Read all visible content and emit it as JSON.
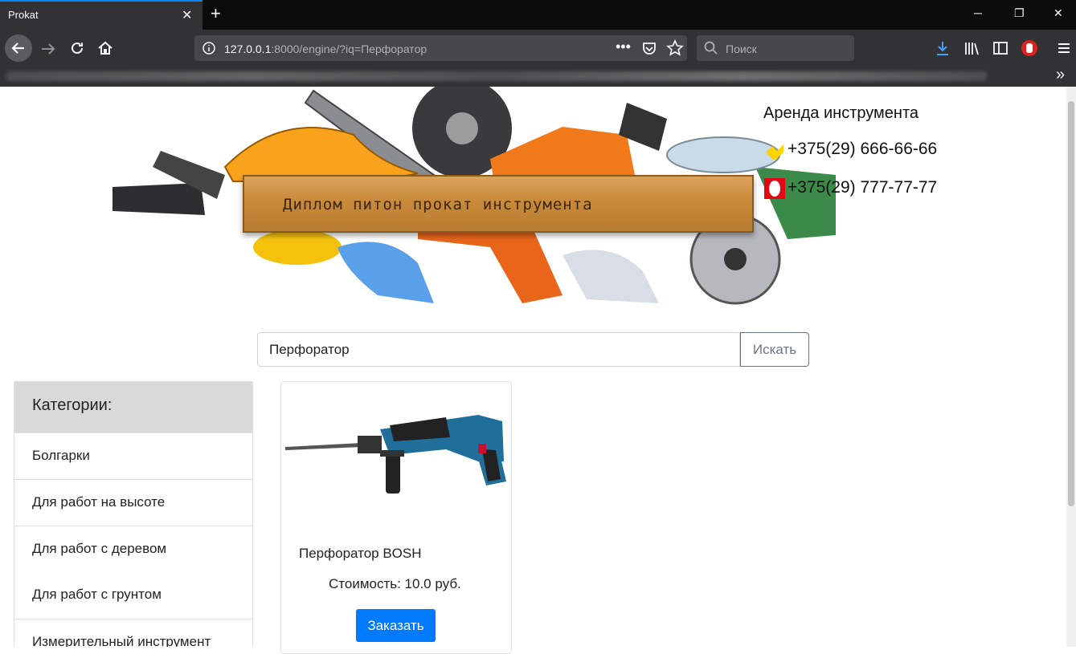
{
  "browser": {
    "tab_title": "Prokat",
    "url_host": "127.0.0.1",
    "url_rest": ":8000/engine/?iq=Перфоратор",
    "search_placeholder": "Поиск"
  },
  "header": {
    "banner_text": "Диплом питон прокат инструмента",
    "rent_title": "Аренда инструмента",
    "phones": [
      {
        "number": "+375(29) 666-66-66",
        "operator_color": "#ffd400"
      },
      {
        "number": "+375(29) 777-77-77",
        "operator_color": "#e30613"
      }
    ]
  },
  "search": {
    "value": "Перфоратор",
    "button_label": "Искать"
  },
  "categories": {
    "title": "Категории:",
    "items": [
      "Болгарки",
      "Для работ на высоте",
      "Для работ с деревом",
      "Для работ с грунтом",
      "Измерительный инструмент"
    ]
  },
  "products": [
    {
      "name": "Перфоратор BOSH",
      "price": "Стоимость: 10.0 руб.",
      "order_label": "Заказать"
    }
  ],
  "colors": {
    "primary": "#007bff",
    "chrome_dark": "#323234"
  }
}
